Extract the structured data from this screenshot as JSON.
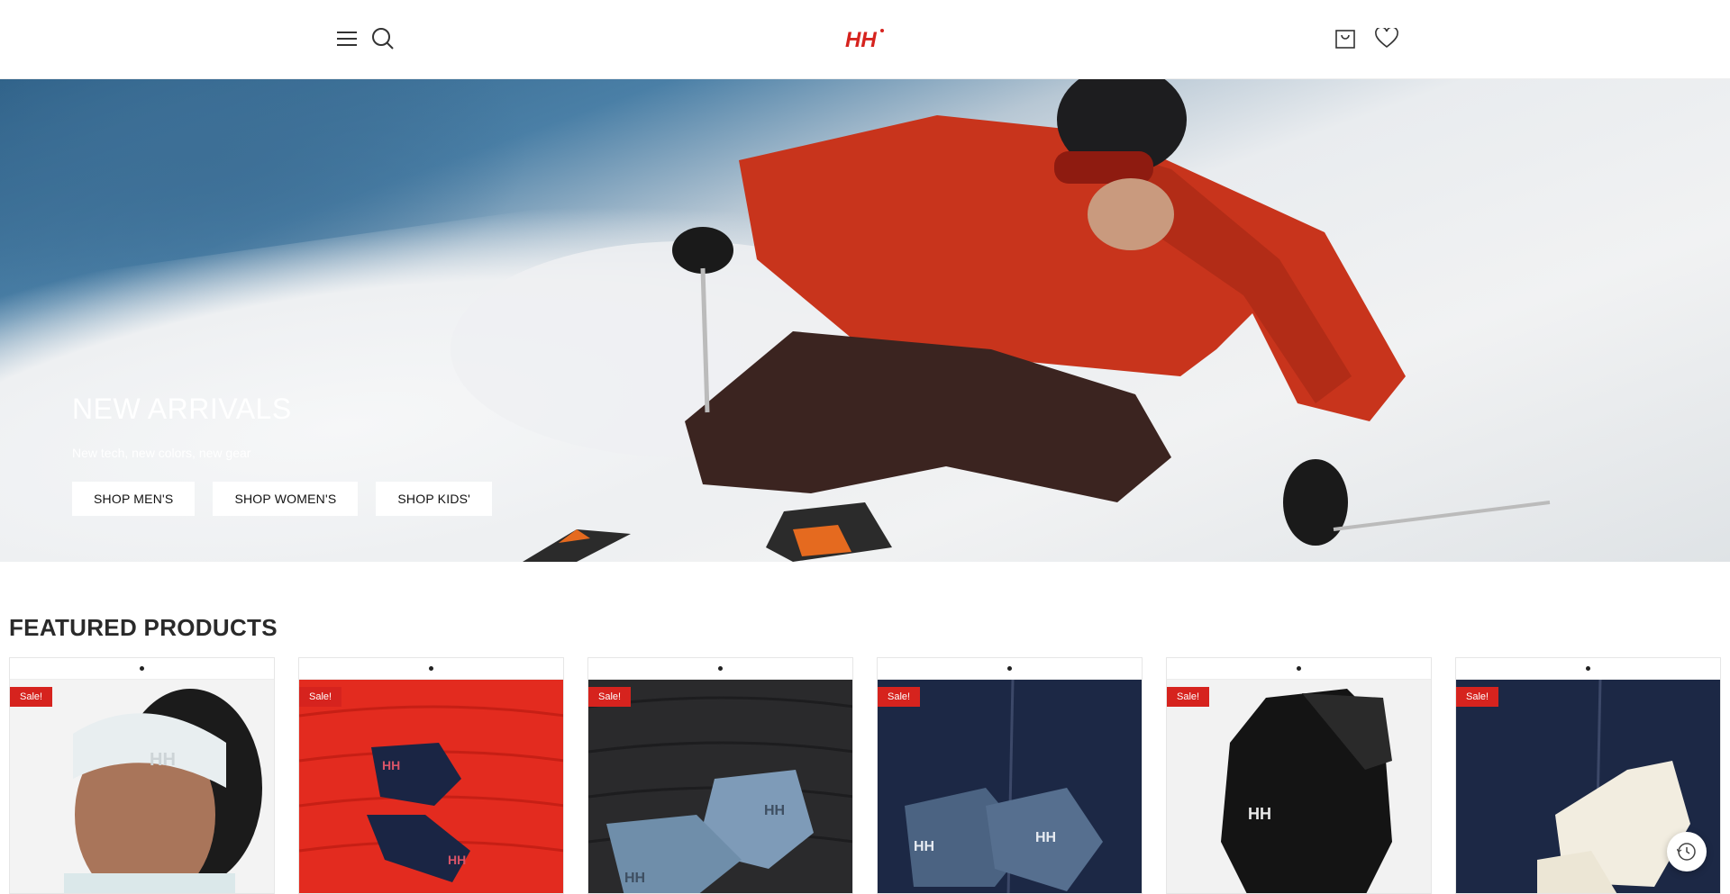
{
  "header": {
    "menu_icon": "menu-icon",
    "search_icon": "search-icon",
    "logo_text": "HH",
    "cart_icon": "cart-icon",
    "wishlist_icon": "heart-icon",
    "brand_color": "#d6231e"
  },
  "hero": {
    "title": "NEW ARRIVALS",
    "subtitle": "New tech, new colors, new gear",
    "buttons": [
      "SHOP MEN'S",
      "SHOP WOMEN'S",
      "SHOP KIDS'"
    ]
  },
  "featured": {
    "title": "FEATURED PRODUCTS",
    "products": [
      {
        "badge": "Sale!",
        "image": "white-headband"
      },
      {
        "badge": "Sale!",
        "image": "navy-gloves-red-jacket"
      },
      {
        "badge": "Sale!",
        "image": "blue-gloves-black-jacket"
      },
      {
        "badge": "Sale!",
        "image": "navy-gloves-navy-jacket"
      },
      {
        "badge": "Sale!",
        "image": "black-mittens"
      },
      {
        "badge": "Sale!",
        "image": "white-gloves-navy-jacket"
      }
    ]
  },
  "history_icon": "history-icon"
}
